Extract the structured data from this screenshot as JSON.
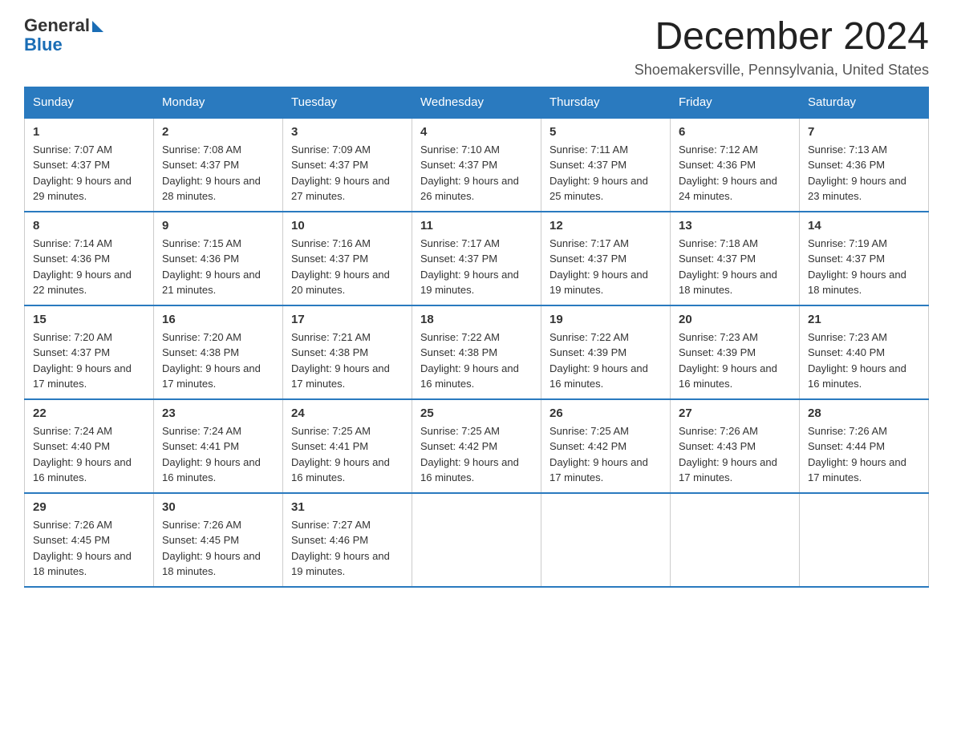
{
  "logo": {
    "general": "General",
    "blue": "Blue"
  },
  "title": "December 2024",
  "location": "Shoemakersville, Pennsylvania, United States",
  "headers": [
    "Sunday",
    "Monday",
    "Tuesday",
    "Wednesday",
    "Thursday",
    "Friday",
    "Saturday"
  ],
  "weeks": [
    [
      {
        "day": "1",
        "sunrise": "7:07 AM",
        "sunset": "4:37 PM",
        "daylight": "9 hours and 29 minutes."
      },
      {
        "day": "2",
        "sunrise": "7:08 AM",
        "sunset": "4:37 PM",
        "daylight": "9 hours and 28 minutes."
      },
      {
        "day": "3",
        "sunrise": "7:09 AM",
        "sunset": "4:37 PM",
        "daylight": "9 hours and 27 minutes."
      },
      {
        "day": "4",
        "sunrise": "7:10 AM",
        "sunset": "4:37 PM",
        "daylight": "9 hours and 26 minutes."
      },
      {
        "day": "5",
        "sunrise": "7:11 AM",
        "sunset": "4:37 PM",
        "daylight": "9 hours and 25 minutes."
      },
      {
        "day": "6",
        "sunrise": "7:12 AM",
        "sunset": "4:36 PM",
        "daylight": "9 hours and 24 minutes."
      },
      {
        "day": "7",
        "sunrise": "7:13 AM",
        "sunset": "4:36 PM",
        "daylight": "9 hours and 23 minutes."
      }
    ],
    [
      {
        "day": "8",
        "sunrise": "7:14 AM",
        "sunset": "4:36 PM",
        "daylight": "9 hours and 22 minutes."
      },
      {
        "day": "9",
        "sunrise": "7:15 AM",
        "sunset": "4:36 PM",
        "daylight": "9 hours and 21 minutes."
      },
      {
        "day": "10",
        "sunrise": "7:16 AM",
        "sunset": "4:37 PM",
        "daylight": "9 hours and 20 minutes."
      },
      {
        "day": "11",
        "sunrise": "7:17 AM",
        "sunset": "4:37 PM",
        "daylight": "9 hours and 19 minutes."
      },
      {
        "day": "12",
        "sunrise": "7:17 AM",
        "sunset": "4:37 PM",
        "daylight": "9 hours and 19 minutes."
      },
      {
        "day": "13",
        "sunrise": "7:18 AM",
        "sunset": "4:37 PM",
        "daylight": "9 hours and 18 minutes."
      },
      {
        "day": "14",
        "sunrise": "7:19 AM",
        "sunset": "4:37 PM",
        "daylight": "9 hours and 18 minutes."
      }
    ],
    [
      {
        "day": "15",
        "sunrise": "7:20 AM",
        "sunset": "4:37 PM",
        "daylight": "9 hours and 17 minutes."
      },
      {
        "day": "16",
        "sunrise": "7:20 AM",
        "sunset": "4:38 PM",
        "daylight": "9 hours and 17 minutes."
      },
      {
        "day": "17",
        "sunrise": "7:21 AM",
        "sunset": "4:38 PM",
        "daylight": "9 hours and 17 minutes."
      },
      {
        "day": "18",
        "sunrise": "7:22 AM",
        "sunset": "4:38 PM",
        "daylight": "9 hours and 16 minutes."
      },
      {
        "day": "19",
        "sunrise": "7:22 AM",
        "sunset": "4:39 PM",
        "daylight": "9 hours and 16 minutes."
      },
      {
        "day": "20",
        "sunrise": "7:23 AM",
        "sunset": "4:39 PM",
        "daylight": "9 hours and 16 minutes."
      },
      {
        "day": "21",
        "sunrise": "7:23 AM",
        "sunset": "4:40 PM",
        "daylight": "9 hours and 16 minutes."
      }
    ],
    [
      {
        "day": "22",
        "sunrise": "7:24 AM",
        "sunset": "4:40 PM",
        "daylight": "9 hours and 16 minutes."
      },
      {
        "day": "23",
        "sunrise": "7:24 AM",
        "sunset": "4:41 PM",
        "daylight": "9 hours and 16 minutes."
      },
      {
        "day": "24",
        "sunrise": "7:25 AM",
        "sunset": "4:41 PM",
        "daylight": "9 hours and 16 minutes."
      },
      {
        "day": "25",
        "sunrise": "7:25 AM",
        "sunset": "4:42 PM",
        "daylight": "9 hours and 16 minutes."
      },
      {
        "day": "26",
        "sunrise": "7:25 AM",
        "sunset": "4:42 PM",
        "daylight": "9 hours and 17 minutes."
      },
      {
        "day": "27",
        "sunrise": "7:26 AM",
        "sunset": "4:43 PM",
        "daylight": "9 hours and 17 minutes."
      },
      {
        "day": "28",
        "sunrise": "7:26 AM",
        "sunset": "4:44 PM",
        "daylight": "9 hours and 17 minutes."
      }
    ],
    [
      {
        "day": "29",
        "sunrise": "7:26 AM",
        "sunset": "4:45 PM",
        "daylight": "9 hours and 18 minutes."
      },
      {
        "day": "30",
        "sunrise": "7:26 AM",
        "sunset": "4:45 PM",
        "daylight": "9 hours and 18 minutes."
      },
      {
        "day": "31",
        "sunrise": "7:27 AM",
        "sunset": "4:46 PM",
        "daylight": "9 hours and 19 minutes."
      },
      null,
      null,
      null,
      null
    ]
  ]
}
